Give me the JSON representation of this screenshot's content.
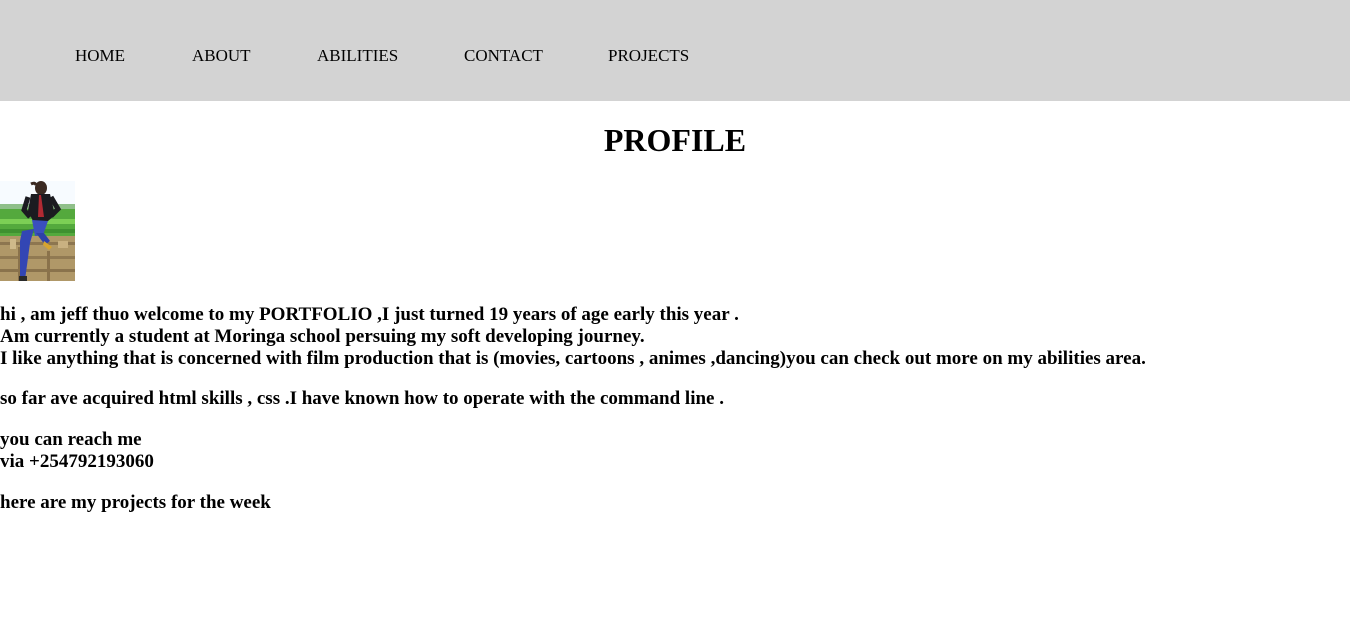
{
  "nav": {
    "items": [
      {
        "label": "HOME"
      },
      {
        "label": "ABOUT"
      },
      {
        "label": "ABILITIES"
      },
      {
        "label": "CONTACT"
      },
      {
        "label": "PROJECTS"
      }
    ],
    "background": "#d3d3d3"
  },
  "profile": {
    "title": "PROFILE",
    "intro_lines": [
      "hi , am jeff thuo welcome to my PORTFOLIO ,I just turned 19 years of age early this year .",
      "Am currently a student at Moringa school persuing my soft developing journey.",
      "I like anything that is concerned with film production that is (movies, cartoons , animes ,dancing)you can check out more on my abilities area."
    ],
    "skills": "so far ave acquired html skills , css .I have known how to operate with the command line .",
    "contact_lines": [
      "you can reach me",
      "via +254792193060"
    ],
    "projects_intro": "here are my projects for the week"
  }
}
